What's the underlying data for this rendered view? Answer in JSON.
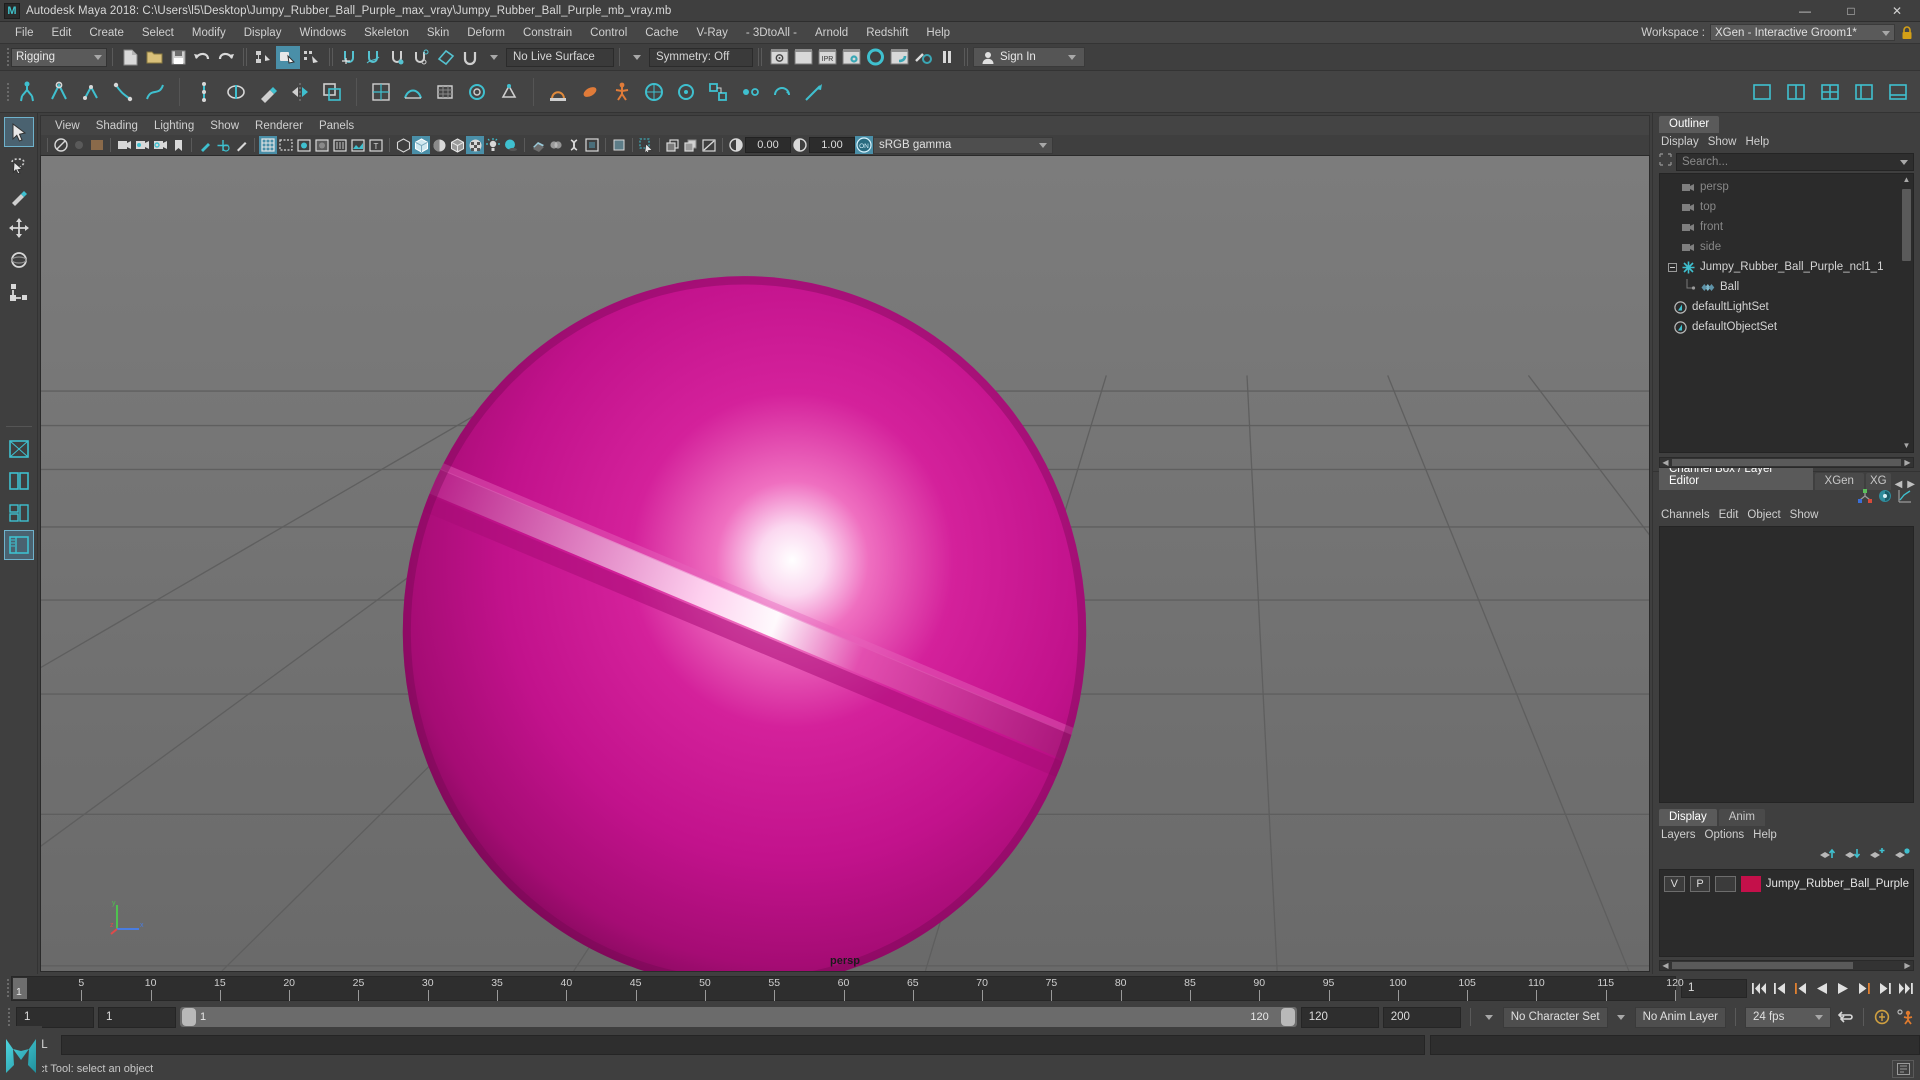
{
  "window": {
    "title": "Autodesk Maya 2018: C:\\Users\\l5\\Desktop\\Jumpy_Rubber_Ball_Purple_max_vray\\Jumpy_Rubber_Ball_Purple_mb_vray.mb",
    "logo": "M",
    "minimize": "—",
    "maximize": "□",
    "close": "✕"
  },
  "menubar": {
    "items": [
      "File",
      "Edit",
      "Create",
      "Select",
      "Modify",
      "Display",
      "Windows",
      "Skeleton",
      "Skin",
      "Deform",
      "Constrain",
      "Control",
      "Cache",
      "V-Ray",
      "- 3DtoAll -",
      "Arnold",
      "Redshift",
      "Help"
    ],
    "workspace_label": "Workspace :",
    "workspace_value": "XGen - Interactive Groom1*",
    "lock_icon": "lock-icon"
  },
  "statusline": {
    "menuset": "Rigging",
    "live_surface": "No Live Surface",
    "symmetry": "Symmetry: Off",
    "signin": "Sign In",
    "icons": [
      "new-scene-icon",
      "open-scene-icon",
      "save-scene-icon",
      "undo-icon",
      "redo-icon",
      "select-by-hierarchy-icon",
      "select-by-object-icon",
      "select-by-component-icon",
      "snap-to-grid-icon",
      "snap-to-curve-icon",
      "snap-to-point-icon",
      "snap-to-projected-center-icon",
      "snap-to-view-plane-icon",
      "magnet-icon",
      "render-current-frame-icon",
      "ipr-render-icon",
      "render-settings-icon",
      "hypershade-icon",
      "render-view-icon",
      "rendering-flags-icon",
      "pause-icon"
    ]
  },
  "shelf": {
    "tabs": [],
    "icons": [
      "quick-rig-icon",
      "skeleton-icon",
      "joint-tool-icon",
      "ik-handle-icon",
      "ik-spline-icon",
      "insert-joint-icon",
      "bind-skin-icon",
      "paint-weights-icon",
      "mirror-weights-icon",
      "copy-weights-icon",
      "smooth-bind-icon",
      "deformer-icon",
      "blend-shape-icon",
      "lattice-icon",
      "wrap-icon",
      "cluster-icon",
      "nonlinear-icon",
      "wire-icon",
      "muscle-icon",
      "pose-icon",
      "control-icon",
      "constraint-icon",
      "parent-constraint-icon",
      "point-constraint-icon",
      "orient-constraint-icon",
      "scale-constraint-icon",
      "aim-constraint-icon"
    ],
    "right_icons": [
      "layout-single-icon",
      "layout-two-pane-icon",
      "layout-four-view-icon",
      "layout-outliner-icon",
      "layout-graph-icon"
    ]
  },
  "toolbox": {
    "tools": [
      {
        "name": "select-tool-icon",
        "selected": false
      },
      {
        "name": "lasso-select-tool-icon",
        "selected": false
      },
      {
        "name": "paint-select-tool-icon",
        "selected": false
      },
      {
        "name": "move-tool-icon",
        "selected": false
      },
      {
        "name": "rotate-tool-icon",
        "selected": false
      },
      {
        "name": "scale-tool-icon",
        "selected": false
      }
    ],
    "layouts": [
      {
        "name": "layout-single-pane-icon",
        "selected": false
      },
      {
        "name": "layout-side-by-side-icon",
        "selected": false
      },
      {
        "name": "layout-three-pane-icon",
        "selected": false
      },
      {
        "name": "layout-persp-outliner-icon",
        "selected": true
      }
    ]
  },
  "viewport": {
    "menus": [
      "View",
      "Shading",
      "Lighting",
      "Show",
      "Renderer",
      "Panels"
    ],
    "camera_label": "persp",
    "exposure": "0.00",
    "gamma": "1.00",
    "color_management": "sRGB gamma",
    "toolbar_icons": [
      "select-camera-icon",
      "lock-camera-icon",
      "camera-attributes-icon",
      "bookmark-icon",
      "image-plane-icon",
      "two-d-pan-zoom-icon",
      "grease-pencil-icon",
      "grid-icon",
      "film-gate-icon",
      "resolution-gate-icon",
      "gate-mask-icon",
      "field-chart-icon",
      "safe-action-icon",
      "safe-title-icon",
      "wireframe-icon",
      "smooth-shade-icon",
      "flat-shade-icon",
      "shaded-wireframe-icon",
      "textured-icon",
      "use-all-lights-icon",
      "shadows-icon",
      "screen-space-ao-icon",
      "motion-blur-icon",
      "multisample-icon",
      "depth-of-field-icon",
      "isolate-select-icon",
      "xray-icon",
      "xray-joints-icon",
      "xray-active-components-icon",
      "exposure-icon",
      "gamma-icon",
      "color-management-toggle-icon"
    ],
    "object_color": "#c7158e",
    "ball_highlight": "#ffffff",
    "ground_color": "#6e6e6e"
  },
  "outliner": {
    "tab": "Outliner",
    "menus": [
      "Display",
      "Show",
      "Help"
    ],
    "search_placeholder": "Search...",
    "items": [
      {
        "label": "persp",
        "icon": "camera-icon",
        "dim": true,
        "indent": 1
      },
      {
        "label": "top",
        "icon": "camera-icon",
        "dim": true,
        "indent": 1
      },
      {
        "label": "front",
        "icon": "camera-icon",
        "dim": true,
        "indent": 1
      },
      {
        "label": "side",
        "icon": "camera-icon",
        "dim": true,
        "indent": 1
      },
      {
        "label": "Jumpy_Rubber_Ball_Purple_ncl1_1",
        "icon": "transform-icon",
        "dim": false,
        "indent": 1,
        "expanded": true
      },
      {
        "label": "Ball",
        "icon": "mesh-icon",
        "dim": false,
        "indent": 2
      },
      {
        "label": "defaultLightSet",
        "icon": "set-icon",
        "dim": false,
        "indent": 1
      },
      {
        "label": "defaultObjectSet",
        "icon": "set-icon",
        "dim": false,
        "indent": 1
      }
    ]
  },
  "channelbox": {
    "tabs": [
      {
        "label": "Channel Box / Layer Editor",
        "active": true
      },
      {
        "label": "XGen",
        "active": false
      },
      {
        "label": "XG",
        "active": false
      }
    ],
    "menus": [
      "Channels",
      "Edit",
      "Object",
      "Show"
    ],
    "icons": [
      "channel-box-icon",
      "attribute-editor-icon",
      "graph-editor-icon"
    ],
    "nav_prev": "◀",
    "nav_next": "▶"
  },
  "layereditor": {
    "tabs": [
      {
        "label": "Display",
        "active": true
      },
      {
        "label": "Anim",
        "active": false
      }
    ],
    "menus": [
      "Layers",
      "Options",
      "Help"
    ],
    "toolbar_icons": [
      "move-layer-up-icon",
      "move-layer-down-icon",
      "new-layer-from-selected-icon",
      "new-layer-icon"
    ],
    "layers": [
      {
        "visibility": "V",
        "playback": "P",
        "shading": "",
        "color": "#c4104a",
        "name": "Jumpy_Rubber_Ball_Purple"
      }
    ]
  },
  "timeslider": {
    "current_frame": "1",
    "end_marker": "120",
    "frame_field": "1",
    "ticks": [
      {
        "value": "5",
        "frame": 5
      },
      {
        "value": "10",
        "frame": 10
      },
      {
        "value": "15",
        "frame": 15
      },
      {
        "value": "20",
        "frame": 20
      },
      {
        "value": "25",
        "frame": 25
      },
      {
        "value": "30",
        "frame": 30
      },
      {
        "value": "35",
        "frame": 35
      },
      {
        "value": "40",
        "frame": 40
      },
      {
        "value": "45",
        "frame": 45
      },
      {
        "value": "50",
        "frame": 50
      },
      {
        "value": "55",
        "frame": 55
      },
      {
        "value": "60",
        "frame": 60
      },
      {
        "value": "65",
        "frame": 65
      },
      {
        "value": "70",
        "frame": 70
      },
      {
        "value": "75",
        "frame": 75
      },
      {
        "value": "80",
        "frame": 80
      },
      {
        "value": "85",
        "frame": 85
      },
      {
        "value": "90",
        "frame": 90
      },
      {
        "value": "95",
        "frame": 95
      },
      {
        "value": "100",
        "frame": 100
      },
      {
        "value": "105",
        "frame": 105
      },
      {
        "value": "110",
        "frame": 110
      },
      {
        "value": "115",
        "frame": 115
      },
      {
        "value": "120",
        "frame": 120
      }
    ],
    "range_start": 1,
    "range_end": 120,
    "playback_buttons": [
      "go-to-start-icon",
      "step-back-keyframe-icon",
      "step-back-frame-icon",
      "play-backwards-icon",
      "play-forwards-icon",
      "step-forward-frame-icon",
      "step-forward-keyframe-icon",
      "go-to-end-icon"
    ]
  },
  "rangeslider": {
    "anim_start": "1",
    "playback_start": "1",
    "slider_min_label": "1",
    "slider_max_label": "120",
    "playback_end": "120",
    "anim_end": "200",
    "character_set": "No Character Set",
    "anim_layer": "No Anim Layer",
    "fps": "24 fps",
    "icons": [
      "auto-key-icon",
      "animation-preferences-icon",
      "cycle-icon"
    ]
  },
  "commandline": {
    "mode_label": "MEL",
    "input_value": "",
    "output_value": ""
  },
  "helpline": {
    "message": "Select Tool: select an object",
    "logo": "M"
  }
}
